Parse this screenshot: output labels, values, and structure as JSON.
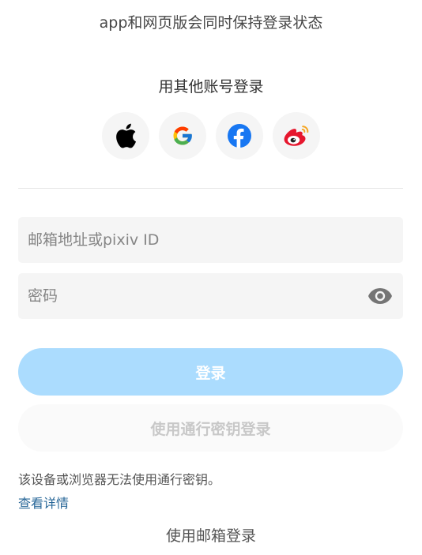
{
  "header": {
    "keep_logged_in_note": "app和网页版会同时保持登录状态"
  },
  "social_login": {
    "title": "用其他账号登录",
    "providers": [
      {
        "icon": "apple-icon",
        "color": "#000000"
      },
      {
        "icon": "google-icon",
        "color": "#4285F4"
      },
      {
        "icon": "facebook-icon",
        "color": "#1877F2"
      },
      {
        "icon": "weibo-icon",
        "color": "#E6162D"
      }
    ]
  },
  "form": {
    "email_placeholder": "邮箱地址或pixiv ID",
    "email_value": "",
    "password_placeholder": "密码",
    "password_value": "",
    "show_password_icon": "eye-icon"
  },
  "buttons": {
    "login_label": "登录",
    "passkey_label": "使用通行密钥登录"
  },
  "passkey_notice": {
    "text": "该设备或浏览器无法使用通行密钥。",
    "link_label": "查看详情"
  },
  "footer": {
    "email_login_label": "使用邮箱登录"
  },
  "colors": {
    "primary_disabled": "#abdcfe",
    "link": "#2a6899",
    "field_background": "#f5f5f5"
  }
}
